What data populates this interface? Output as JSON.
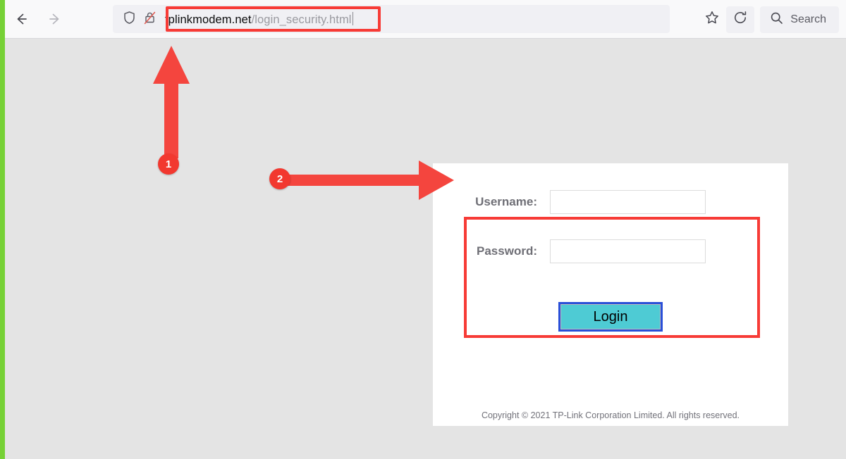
{
  "browser": {
    "nav": {
      "back_icon": "arrow-left-icon",
      "forward_icon": "arrow-right-icon"
    },
    "urlbar": {
      "shield_icon": "shield-icon",
      "insecure_lock_icon": "lock-crossed-out-icon",
      "url_host": "tplinkmodem.net",
      "url_path": "/login_security.html",
      "full_url": "tplinkmodem.net/login_security.html"
    },
    "actions": {
      "bookmark_icon": "star-icon",
      "reload_icon": "reload-icon",
      "search_icon": "search-icon",
      "search_label": "Search",
      "search_placeholder": "Search"
    }
  },
  "page": {
    "form": {
      "username_label": "Username:",
      "username_value": "",
      "username_placeholder": "",
      "password_label": "Password:",
      "password_value": "",
      "password_placeholder": ""
    },
    "login_button_label": "Login",
    "copyright": "Copyright © 2021 TP-Link Corporation Limited. All rights reserved."
  },
  "annotations": {
    "badge_1": "1",
    "badge_2": "2",
    "highlight_color": "#f73b36",
    "arrow_color": "#f4453e",
    "badge_color": "#f2382f"
  },
  "colors": {
    "page_background": "#e4e4e4",
    "toolbar_background": "#f9f9fa",
    "urlbar_pill": "#f0f0f4",
    "card_background": "#ffffff",
    "login_button": "#4ecbd4",
    "login_button_focus_ring": "#2a4fd8",
    "left_strip": "#76d136"
  }
}
